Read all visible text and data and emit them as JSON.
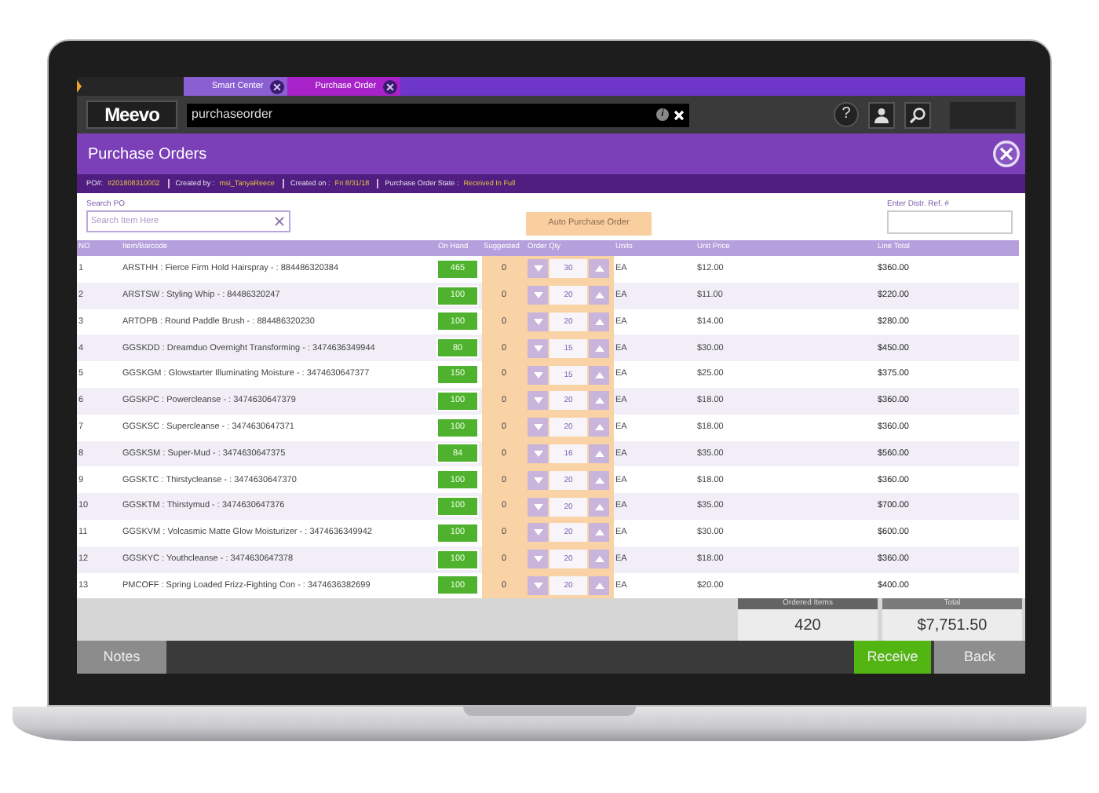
{
  "tabs": [
    {
      "label": "Smart Center",
      "selected": false
    },
    {
      "label": "Purchase Order",
      "selected": true
    }
  ],
  "top_bar": {
    "logo": "Meevo",
    "search_value": "purchaseorder",
    "info_glyph": "i",
    "help_glyph": "?"
  },
  "title": "Purchase Orders",
  "info": [
    {
      "label": "PO#:",
      "value": "#201808310002"
    },
    {
      "label": "Created by :",
      "value": "msi_TanyaReece"
    },
    {
      "label": "Created on :",
      "value": "Fri 8/31/18"
    },
    {
      "label": "Purchase Order State :",
      "value": "Received In Full"
    }
  ],
  "search_po": {
    "label": "Search PO",
    "placeholder": "Search Item Here"
  },
  "auto_button": "Auto Purchase Order",
  "distr_ref": {
    "label": "Enter Distr. Ref. #"
  },
  "table": {
    "columns": [
      "NO",
      "Item/Barcode",
      "On Hand",
      "Suggested",
      "Order Qty",
      "Units",
      "Unit Price",
      "Line Total"
    ],
    "rows": [
      {
        "no": "1",
        "item": "ARSTHH : Fierce Firm Hold Hairspray - : 884486320384",
        "on_hand": "465",
        "suggested": "0",
        "order_qty": "30",
        "units": "EA",
        "unit_price": "$12.00",
        "line_total": "$360.00"
      },
      {
        "no": "2",
        "item": "ARSTSW : Styling Whip - : 84486320247",
        "on_hand": "100",
        "suggested": "0",
        "order_qty": "20",
        "units": "EA",
        "unit_price": "$11.00",
        "line_total": "$220.00"
      },
      {
        "no": "3",
        "item": "ARTOPB : Round Paddle Brush - : 884486320230",
        "on_hand": "100",
        "suggested": "0",
        "order_qty": "20",
        "units": "EA",
        "unit_price": "$14.00",
        "line_total": "$280.00"
      },
      {
        "no": "4",
        "item": "GGSKDD : Dreamduo Overnight Transforming - : 3474636349944",
        "on_hand": "80",
        "suggested": "0",
        "order_qty": "15",
        "units": "EA",
        "unit_price": "$30.00",
        "line_total": "$450.00"
      },
      {
        "no": "5",
        "item": "GGSKGM : Glowstarter Illuminating Moisture - : 3474630647377",
        "on_hand": "150",
        "suggested": "0",
        "order_qty": "15",
        "units": "EA",
        "unit_price": "$25.00",
        "line_total": "$375.00"
      },
      {
        "no": "6",
        "item": "GGSKPC : Powercleanse - : 3474630647379",
        "on_hand": "100",
        "suggested": "0",
        "order_qty": "20",
        "units": "EA",
        "unit_price": "$18.00",
        "line_total": "$360.00"
      },
      {
        "no": "7",
        "item": "GGSKSC : Supercleanse - : 3474630647371",
        "on_hand": "100",
        "suggested": "0",
        "order_qty": "20",
        "units": "EA",
        "unit_price": "$18.00",
        "line_total": "$360.00"
      },
      {
        "no": "8",
        "item": "GGSKSM : Super-Mud - : 3474630647375",
        "on_hand": "84",
        "suggested": "0",
        "order_qty": "16",
        "units": "EA",
        "unit_price": "$35.00",
        "line_total": "$560.00"
      },
      {
        "no": "9",
        "item": "GGSKTC : Thirstycleanse - : 3474630647370",
        "on_hand": "100",
        "suggested": "0",
        "order_qty": "20",
        "units": "EA",
        "unit_price": "$18.00",
        "line_total": "$360.00"
      },
      {
        "no": "10",
        "item": "GGSKTM : Thirstymud - : 3474630647376",
        "on_hand": "100",
        "suggested": "0",
        "order_qty": "20",
        "units": "EA",
        "unit_price": "$35.00",
        "line_total": "$700.00"
      },
      {
        "no": "11",
        "item": "GGSKVM : Volcasmic Matte Glow Moisturizer - : 3474636349942",
        "on_hand": "100",
        "suggested": "0",
        "order_qty": "20",
        "units": "EA",
        "unit_price": "$30.00",
        "line_total": "$600.00"
      },
      {
        "no": "12",
        "item": "GGSKYC : Youthcleanse - : 3474630647378",
        "on_hand": "100",
        "suggested": "0",
        "order_qty": "20",
        "units": "EA",
        "unit_price": "$18.00",
        "line_total": "$360.00"
      },
      {
        "no": "13",
        "item": "PMCOFF : Spring Loaded Frizz-Fighting Con - : 3474636382699",
        "on_hand": "100",
        "suggested": "0",
        "order_qty": "20",
        "units": "EA",
        "unit_price": "$20.00",
        "line_total": "$400.00"
      }
    ]
  },
  "summary": [
    {
      "label": "Ordered Items",
      "value": "420"
    },
    {
      "label": "Total",
      "value": "$7,751.50"
    }
  ],
  "footer": {
    "notes": "Notes",
    "receive": "Receive",
    "back": "Back"
  }
}
